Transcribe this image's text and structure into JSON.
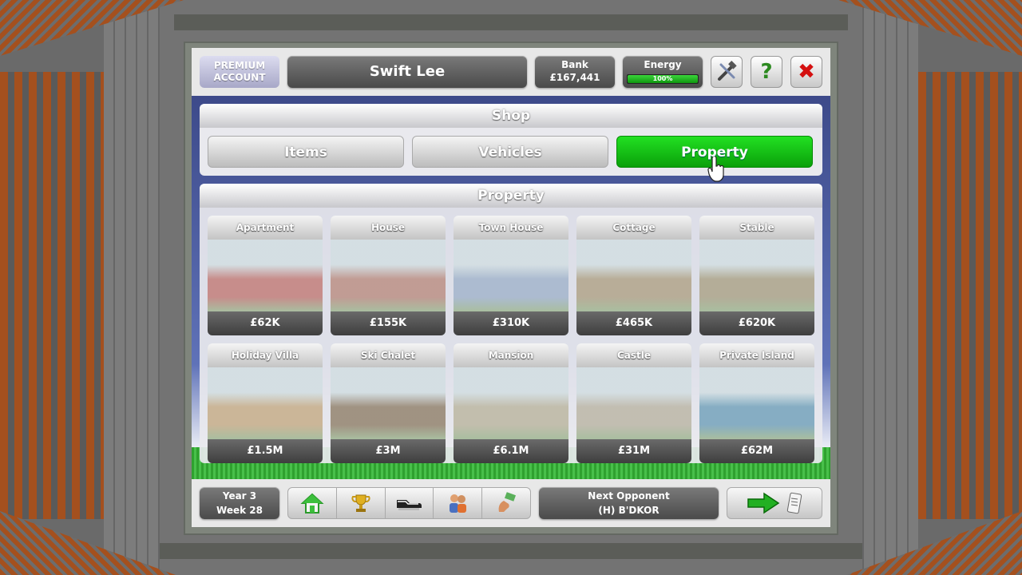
{
  "header": {
    "premium_line1": "PREMIUM",
    "premium_line2": "ACCOUNT",
    "player_name": "Swift Lee",
    "bank_label": "Bank",
    "bank_value": "£167,441",
    "energy_label": "Energy",
    "energy_value": "100%",
    "energy_fraction": 1.0,
    "icons": [
      "tools-icon",
      "help-icon",
      "close-icon"
    ]
  },
  "shop": {
    "title": "Shop",
    "tabs": [
      {
        "label": "Items",
        "active": false
      },
      {
        "label": "Vehicles",
        "active": false
      },
      {
        "label": "Property",
        "active": true
      }
    ]
  },
  "property": {
    "title": "Property",
    "items": [
      {
        "name": "Apartment",
        "price": "£62K",
        "color": "#c0504a"
      },
      {
        "name": "House",
        "price": "£155K",
        "color": "#b56a5a"
      },
      {
        "name": "Town House",
        "price": "£310K",
        "color": "#8fa3c8"
      },
      {
        "name": "Cottage",
        "price": "£465K",
        "color": "#a58a62"
      },
      {
        "name": "Stable",
        "price": "£620K",
        "color": "#9d8a62"
      },
      {
        "name": "Holiday Villa",
        "price": "£1.5M",
        "color": "#c89a62"
      },
      {
        "name": "Ski Chalet",
        "price": "£3M",
        "color": "#7a5a3a"
      },
      {
        "name": "Mansion",
        "price": "£6.1M",
        "color": "#b8a888"
      },
      {
        "name": "Castle",
        "price": "£31M",
        "color": "#b8a890"
      },
      {
        "name": "Private Island",
        "price": "£62M",
        "color": "#4a8ab0"
      }
    ]
  },
  "footer": {
    "year": "Year 3",
    "week": "Week 28",
    "nav_icons": [
      "home-icon",
      "trophy-icon",
      "boot-icon",
      "people-icon",
      "money-hand-icon"
    ],
    "opponent_label": "Next Opponent",
    "opponent_value": "(H) B'DKOR"
  }
}
